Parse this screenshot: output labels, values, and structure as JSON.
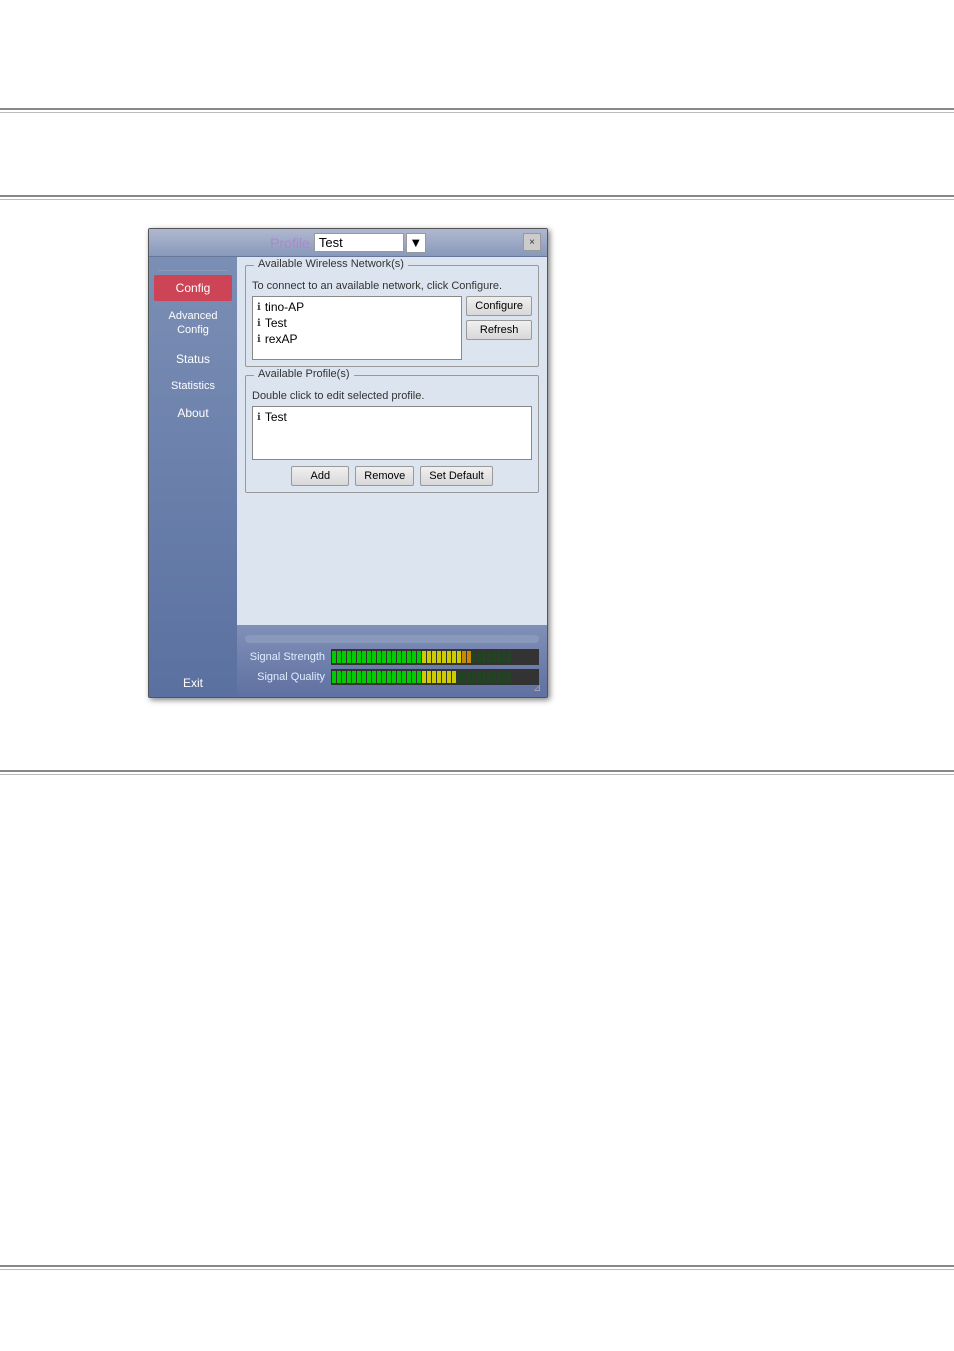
{
  "page": {
    "background": "#ffffff"
  },
  "titlebar": {
    "profile_label": "Profile",
    "test_value": "Test",
    "close_label": "×"
  },
  "sidebar": {
    "items": [
      {
        "id": "config",
        "label": "Config",
        "highlight": true
      },
      {
        "id": "advanced-config",
        "label": "Advanced\nConfig",
        "highlight": false
      },
      {
        "id": "status",
        "label": "Status",
        "highlight": false
      },
      {
        "id": "statistics",
        "label": "Statistics",
        "highlight": false
      },
      {
        "id": "about",
        "label": "About",
        "highlight": false
      },
      {
        "id": "exit",
        "label": "Exit",
        "highlight": false
      }
    ]
  },
  "available_networks": {
    "legend": "Available Wireless Network(s)",
    "hint": "To connect to an available network, click Configure.",
    "networks": [
      {
        "name": "tino-AP"
      },
      {
        "name": "Test"
      },
      {
        "name": "rexAP"
      }
    ],
    "configure_button": "Configure",
    "refresh_button": "Refresh"
  },
  "available_profiles": {
    "legend": "Available Profile(s)",
    "hint": "Double click to edit selected profile.",
    "profiles": [
      {
        "name": "Test"
      }
    ],
    "add_button": "Add",
    "remove_button": "Remove",
    "set_default_button": "Set Default"
  },
  "signal": {
    "strength_label": "Signal Strength",
    "quality_label": "Signal Quality",
    "strength_bars": 28,
    "quality_bars": 25
  }
}
